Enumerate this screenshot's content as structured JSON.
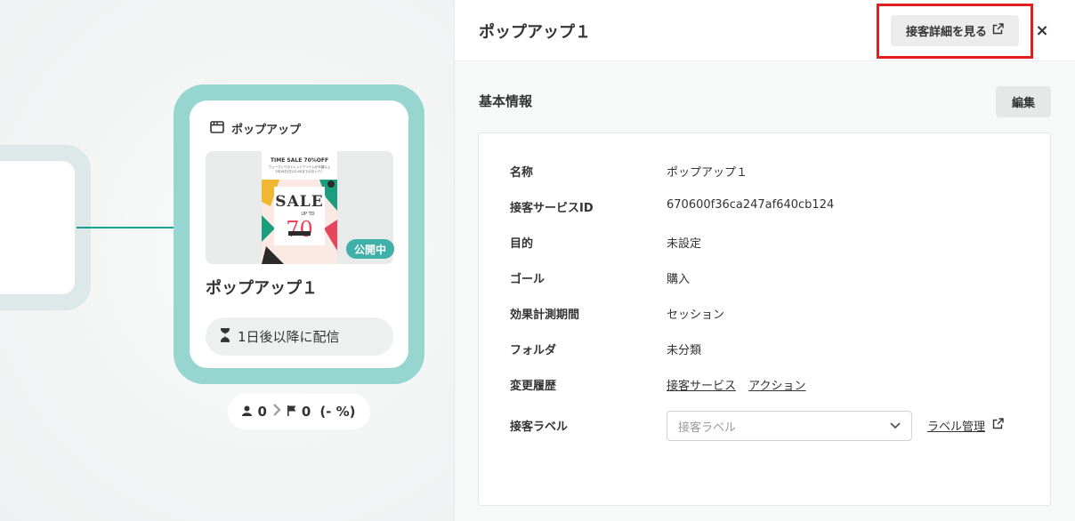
{
  "canvas": {
    "node": {
      "type_label": "ポップアップ",
      "title": "ポップアップ１",
      "status": "公開中",
      "delivery": "1日後以降に配信",
      "thumbnail": {
        "headline": "TIME SALE 70%OFF",
        "line1": "ウェーブシワのトレンドアイテムが半額以上",
        "line2": "3月18日(日)12:00までのおトク！",
        "sale_word": "SALE",
        "up_to": "UP TO",
        "big_number": "70"
      }
    },
    "stats": {
      "users": "0",
      "goals": "0",
      "rate": "(- %)"
    }
  },
  "panel": {
    "title": "ポップアップ１",
    "detail_button": "接客詳細を見る",
    "close": "×",
    "section_title": "基本情報",
    "edit_button": "編集",
    "rows": [
      {
        "label": "名称",
        "value": "ポップアップ１"
      },
      {
        "label": "接客サービスID",
        "value": "670600f36ca247af640cb124"
      },
      {
        "label": "目的",
        "value": "未設定"
      },
      {
        "label": "ゴール",
        "value": "購入"
      },
      {
        "label": "効果計測期間",
        "value": "セッション"
      },
      {
        "label": "フォルダ",
        "value": "未分類"
      }
    ],
    "history": {
      "label": "変更履歴",
      "link1": "接客サービス",
      "link2": "アクション"
    },
    "label_row": {
      "label": "接客ラベル",
      "placeholder": "接客ラベル",
      "manage_link": "ラベル管理"
    }
  },
  "colors": {
    "accent": "#3fb0a8",
    "node_frame": "#97d5d1",
    "connector": "#1a9e96",
    "highlight": "#e01e1e"
  }
}
